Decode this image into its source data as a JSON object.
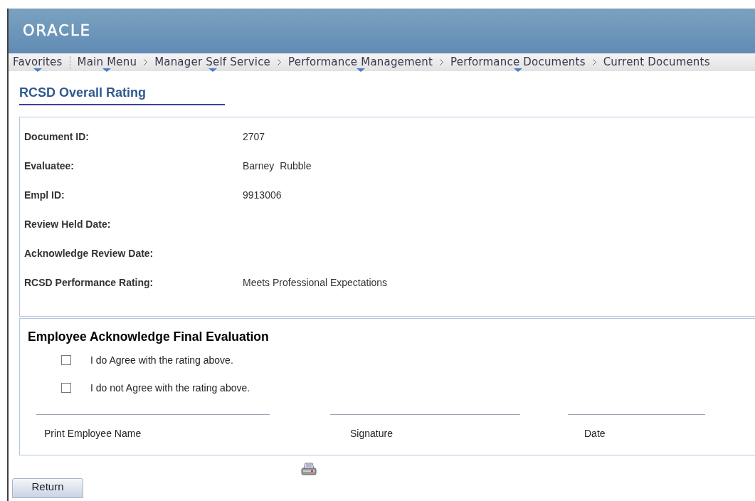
{
  "header": {
    "logo": "ORACLE"
  },
  "breadcrumb": [
    {
      "label": "Favorites",
      "has_menu": true
    },
    {
      "label": "Main Menu",
      "has_menu": true
    },
    {
      "label": "Manager Self Service",
      "has_menu": true
    },
    {
      "label": "Performance Management",
      "has_menu": true
    },
    {
      "label": "Performance Documents",
      "has_menu": true
    },
    {
      "label": "Current Documents",
      "has_menu": false
    }
  ],
  "page_title": "RCSD Overall Rating",
  "fields": [
    {
      "label": "Document ID:",
      "value": "2707"
    },
    {
      "label": "Evaluatee:",
      "value": "Barney  Rubble"
    },
    {
      "label": "Empl ID:",
      "value": "9913006"
    },
    {
      "label": "Review Held Date:"
    },
    {
      "label": "Acknowledge Review Date:"
    },
    {
      "label": "RCSD Performance Rating:",
      "value": "Meets Professional Expectations"
    }
  ],
  "acknowledge": {
    "title": "Employee Acknowledge Final Evaluation",
    "options": [
      {
        "label": "I do Agree with the rating above.",
        "checked": false
      },
      {
        "label": "I do not Agree with the rating above.",
        "checked": false
      }
    ],
    "signature_lines": [
      "Print Employee Name",
      "Signature",
      "Date"
    ]
  },
  "buttons": [
    "Return"
  ]
}
